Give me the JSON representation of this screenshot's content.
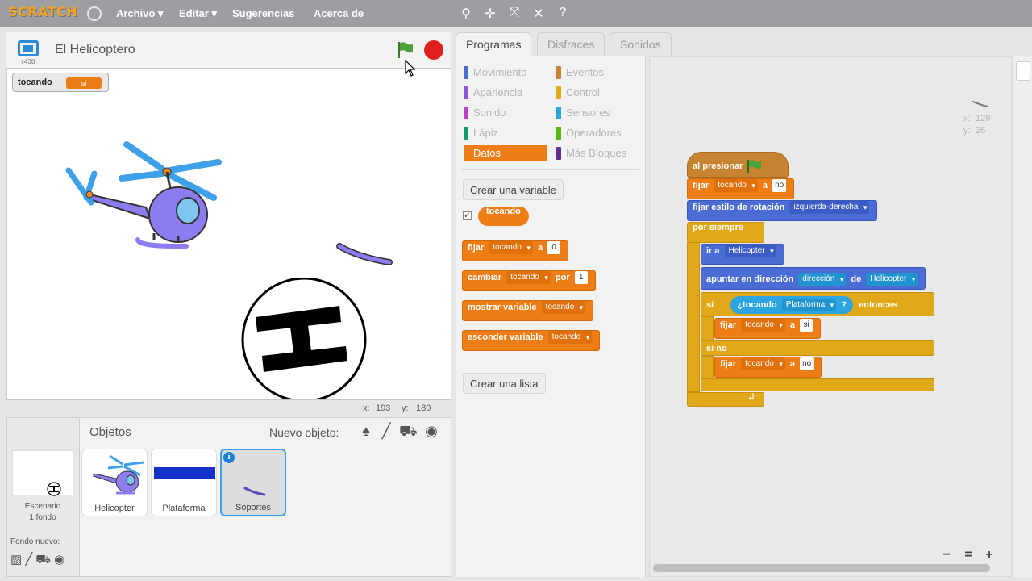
{
  "menu": {
    "logo": "SCRATCH",
    "items": [
      "Archivo ▾",
      "Editar ▾",
      "Sugerencias",
      "Acerca de"
    ]
  },
  "stage": {
    "version": "v438",
    "project_title": "El Helicoptero",
    "variable_monitor": {
      "name": "tocando",
      "value": "si"
    },
    "mouse_x_label": "x:",
    "mouse_x": "193",
    "mouse_y_label": "y:",
    "mouse_y": "180"
  },
  "sprites_panel": {
    "title": "Objetos",
    "new_sprite_label": "Nuevo objeto:",
    "stage_label": "Escenario",
    "backdrops_count": "1 fondo",
    "new_backdrop_label": "Fondo nuevo:",
    "sprites": [
      {
        "name": "Helicopter"
      },
      {
        "name": "Plataforma"
      },
      {
        "name": "Soportes"
      }
    ]
  },
  "tabs": [
    "Programas",
    "Disfraces",
    "Sonidos"
  ],
  "categories": [
    {
      "label": "Movimiento",
      "color": "#4a6cd4"
    },
    {
      "label": "Apariencia",
      "color": "#8a55d7"
    },
    {
      "label": "Sonido",
      "color": "#bb42c3"
    },
    {
      "label": "Lápiz",
      "color": "#0e9a6c"
    },
    {
      "label": "Datos",
      "color": "#ee7d16"
    },
    {
      "label": "Eventos",
      "color": "#c88330"
    },
    {
      "label": "Control",
      "color": "#e1a91a"
    },
    {
      "label": "Sensores",
      "color": "#2ca5e2"
    },
    {
      "label": "Operadores",
      "color": "#5cb712"
    },
    {
      "label": "Más Bloques",
      "color": "#632d99"
    }
  ],
  "palette": {
    "create_variable": "Crear una variable",
    "variable_reporter": "tocando",
    "checkbox_mark": "✓",
    "create_list": "Crear una lista",
    "blocks": {
      "set": {
        "word": "fijar",
        "var": "tocando",
        "to": "a",
        "value": "0"
      },
      "change": {
        "word": "cambiar",
        "var": "tocando",
        "by": "por",
        "value": "1"
      },
      "show": {
        "word": "mostrar variable",
        "var": "tocando"
      },
      "hide": {
        "word": "esconder variable",
        "var": "tocando"
      }
    }
  },
  "script": {
    "when_flag": "al presionar",
    "set1": {
      "word": "fijar",
      "var": "tocando",
      "to": "a",
      "value": "no"
    },
    "rotation": {
      "word": "fijar estilo de rotación",
      "value": "izquierda-derecha"
    },
    "forever": "por siempre",
    "goto": {
      "word": "ir a",
      "value": "Helicopter"
    },
    "point": {
      "word": "apuntar en dirección",
      "attr": "dirección",
      "of": "de",
      "obj": "Helicopter"
    },
    "if": {
      "word": "si",
      "sensing": "¿tocando",
      "obj": "Plataforma",
      "q": "?",
      "then": "entonces"
    },
    "set2": {
      "word": "fijar",
      "var": "tocando",
      "to": "a",
      "value": "si"
    },
    "else": "si no",
    "set3": {
      "word": "fijar",
      "var": "tocando",
      "to": "a",
      "value": "no"
    },
    "loop_arrow": "↲",
    "sprite_x_label": "x:",
    "sprite_x": "129",
    "sprite_y_label": "y:",
    "sprite_y": "26"
  },
  "zoom": {
    "out": "−",
    "reset": "=",
    "in": "+"
  }
}
